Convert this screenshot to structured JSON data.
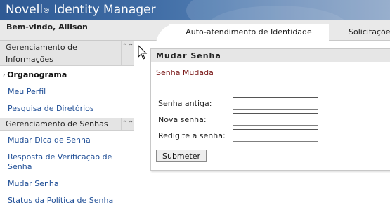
{
  "header": {
    "app_title": "Novell",
    "app_title_reg": "®",
    "app_title_rest": "Identity Manager",
    "welcome": "Bem-vindo, Allison"
  },
  "tabs": [
    {
      "label": "Auto-atendimento de Identidade",
      "active": true
    },
    {
      "label": "Solicitações",
      "active": false
    }
  ],
  "sidebar": {
    "sections": [
      {
        "title": "Gerenciamento de Informações",
        "items": [
          {
            "label": "Organograma",
            "active": true,
            "bullet": "›"
          },
          {
            "label": "Meu Perfil"
          },
          {
            "label": "Pesquisa de Diretórios"
          }
        ]
      },
      {
        "title": "Gerenciamento de Senhas",
        "items": [
          {
            "label": "Mudar Dica de Senha"
          },
          {
            "label": "Resposta de Verificação de Senha"
          },
          {
            "label": "Mudar Senha"
          },
          {
            "label": "Status da Política de Senha"
          }
        ]
      }
    ],
    "collapse_icon": "⌃⌃"
  },
  "panel": {
    "title": "Mudar Senha",
    "status_message": "Senha Mudada",
    "fields": [
      {
        "label": "Senha antiga:",
        "value": ""
      },
      {
        "label": "Nova senha:",
        "value": ""
      },
      {
        "label": "Redigite a senha:",
        "value": ""
      }
    ],
    "submit_label": "Submeter"
  },
  "colors": {
    "banner": "#3d6aa3",
    "link": "#1f4e96",
    "status": "#7b1a1a"
  }
}
